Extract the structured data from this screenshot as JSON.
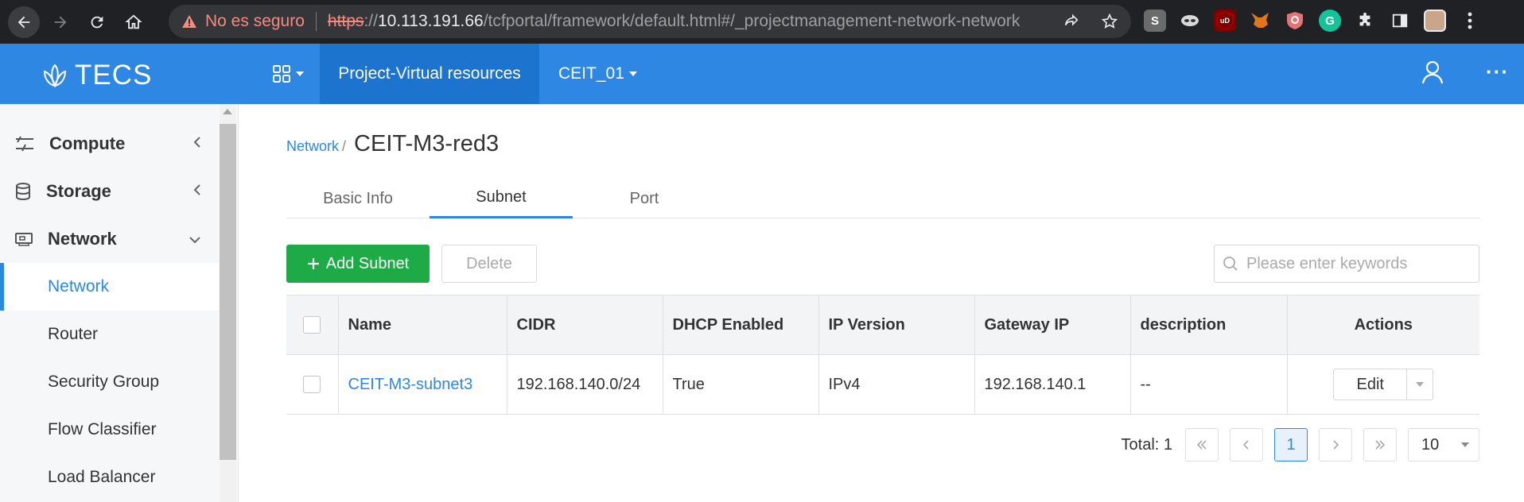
{
  "browser": {
    "security_warning": "No es seguro",
    "url_scheme": "https",
    "url_sep": "://",
    "url_host": "10.113.191.66",
    "url_path": "/tcfportal/framework/default.html#/_projectmanagement-network-network"
  },
  "header": {
    "logo": "TECS",
    "project": "Project-Virtual resources",
    "tenant": "CEIT_01",
    "more": "···"
  },
  "sidebar": {
    "sections": [
      {
        "label": "Compute"
      },
      {
        "label": "Storage"
      },
      {
        "label": "Network"
      }
    ],
    "sub_items": [
      {
        "label": "Network"
      },
      {
        "label": "Router"
      },
      {
        "label": "Security Group"
      },
      {
        "label": "Flow Classifier"
      },
      {
        "label": "Load Balancer"
      }
    ]
  },
  "breadcrumb": {
    "parent": "Network",
    "separator": "/",
    "title": "CEIT-M3-red3"
  },
  "tabs": [
    {
      "label": "Basic Info"
    },
    {
      "label": "Subnet"
    },
    {
      "label": "Port"
    }
  ],
  "toolbar": {
    "add_label": "Add Subnet",
    "delete_label": "Delete",
    "search_placeholder": "Please enter keywords"
  },
  "table": {
    "columns": [
      "Name",
      "CIDR",
      "DHCP Enabled",
      "IP Version",
      "Gateway IP",
      "description",
      "Actions"
    ],
    "rows": [
      {
        "name": "CEIT-M3-subnet3",
        "cidr": "192.168.140.0/24",
        "dhcp": "True",
        "ip_version": "IPv4",
        "gateway": "192.168.140.1",
        "description": "--",
        "action": "Edit"
      }
    ]
  },
  "pagination": {
    "total": "Total: 1",
    "current_page": "1",
    "page_size": "10"
  },
  "colors": {
    "accent": "#2d87e3",
    "add_button": "#1faa48"
  }
}
